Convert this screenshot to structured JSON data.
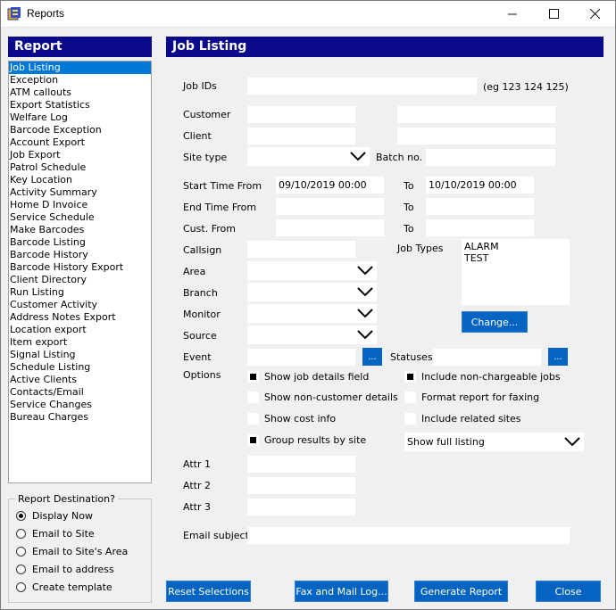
{
  "window": {
    "title": "Reports",
    "min": "—",
    "max": "☐",
    "close": "✕"
  },
  "left": {
    "header": "Report",
    "items": [
      "Job Listing",
      "Exception",
      "ATM callouts",
      "Export Statistics",
      "Welfare Log",
      "Barcode Exception",
      "Account Export",
      "Job Export",
      "Patrol Schedule",
      "Key Location",
      "Activity Summary",
      "Home D Invoice",
      "Service Schedule",
      "Make Barcodes",
      "Barcode Listing",
      "Barcode History",
      "Barcode History Export",
      "Client Directory",
      "Run Listing",
      "Customer Activity",
      "Address Notes Export",
      "Location export",
      "Item export",
      "Signal Listing",
      "Schedule Listing",
      "Active Clients",
      "Contacts/Email",
      "Service Changes",
      "Bureau Charges"
    ],
    "selected": "Job Listing"
  },
  "destination": {
    "legend": "Report Destination?",
    "options": [
      "Display Now",
      "Email to Site",
      "Email to Site's Area",
      "Email to address",
      "Create template"
    ],
    "selected": "Display Now"
  },
  "main": {
    "header": "Job Listing",
    "job_ids_label": "Job IDs",
    "job_ids_value": "",
    "job_ids_hint": "(eg 123 124 125)",
    "customer_label": "Customer",
    "client_label": "Client",
    "site_type_label": "Site type",
    "batch_label": "Batch no.",
    "start_label": "Start Time From",
    "start_from": "09/10/2019 00:00",
    "to_label": "To",
    "start_to": "10/10/2019 00:00",
    "end_label": "End Time From",
    "cust_label": "Cust. From",
    "callsign_label": "Callsign",
    "job_types_label": "Job Types",
    "job_types": [
      "ALARM",
      "TEST"
    ],
    "area_label": "Area",
    "branch_label": "Branch",
    "monitor_label": "Monitor",
    "source_label": "Source",
    "change_button": "Change...",
    "event_label": "Event",
    "statuses_label": "Statuses",
    "ellipsis": "...",
    "options_label": "Options",
    "options": [
      {
        "label": "Show job details field",
        "checked": true
      },
      {
        "label": "Show non-customer details",
        "checked": false
      },
      {
        "label": "Show cost info",
        "checked": false
      },
      {
        "label": "Group results by site",
        "checked": true
      }
    ],
    "options_right": [
      {
        "label": "Include non-chargeable jobs",
        "checked": true
      },
      {
        "label": "Format report for faxing",
        "checked": false
      },
      {
        "label": "Include related sites",
        "checked": false
      }
    ],
    "listing_value": "Show  full listing",
    "attr1_label": "Attr 1",
    "attr2_label": "Attr 2",
    "attr3_label": "Attr 3",
    "email_subject_label": "Email subject"
  },
  "buttons": {
    "reset": "Reset Selections",
    "fax": "Fax and Mail Log...",
    "generate": "Generate Report",
    "close": "Close"
  },
  "colors": {
    "header_bg": "#0a0a8a",
    "button_bg": "#0563c1",
    "selection": "#0078d7"
  }
}
